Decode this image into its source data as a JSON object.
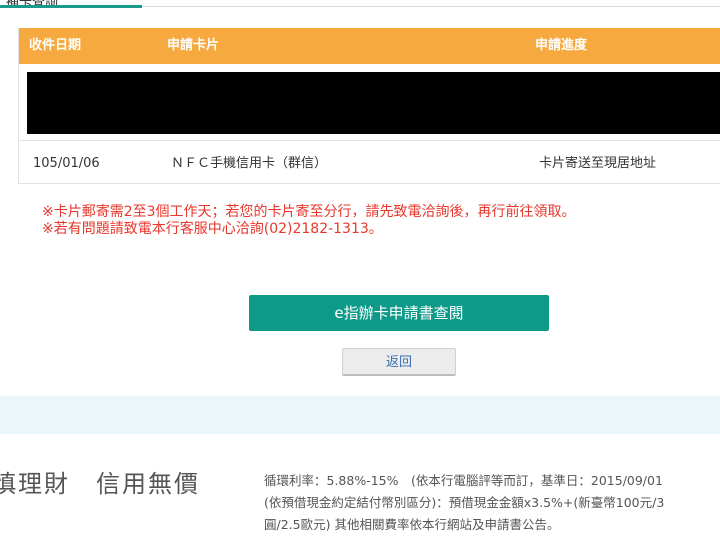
{
  "tab": {
    "label": "補卡查詢"
  },
  "table": {
    "headers": [
      "收件日期",
      "申請卡片",
      "申請進度"
    ],
    "rows": [
      {
        "date": "105/01/06",
        "card": "ＮＦＣ手機信用卡（群信）",
        "status": "卡片寄送至現居地址"
      }
    ]
  },
  "notice": {
    "line1": "※卡片郵寄需2至3個工作天；若您的卡片寄至分行，請先致電洽詢後，再行前往領取。",
    "line2": "※若有問題請致電本行客服中心洽詢(02)2182-1313。"
  },
  "buttons": {
    "e_apply": "e指辦卡申請書查閱",
    "back": "返回"
  },
  "footer": {
    "slogan": "慎理財　信用無價",
    "line1": "循環利率：5.88%-15%　(依本行電腦評等而訂，基準日：2015/09/01",
    "line2": "(依預借現金約定結付幣別區分)：預借現金金額x3.5%+(新臺幣100元/3",
    "line3": "圓/2.5歐元) 其他相關費率依本行網站及申請書公告。"
  },
  "colors": {
    "header": "#f5a93f",
    "accent": "#0d9a88",
    "notice": "#e8372c",
    "band": "#eaf6fa"
  }
}
